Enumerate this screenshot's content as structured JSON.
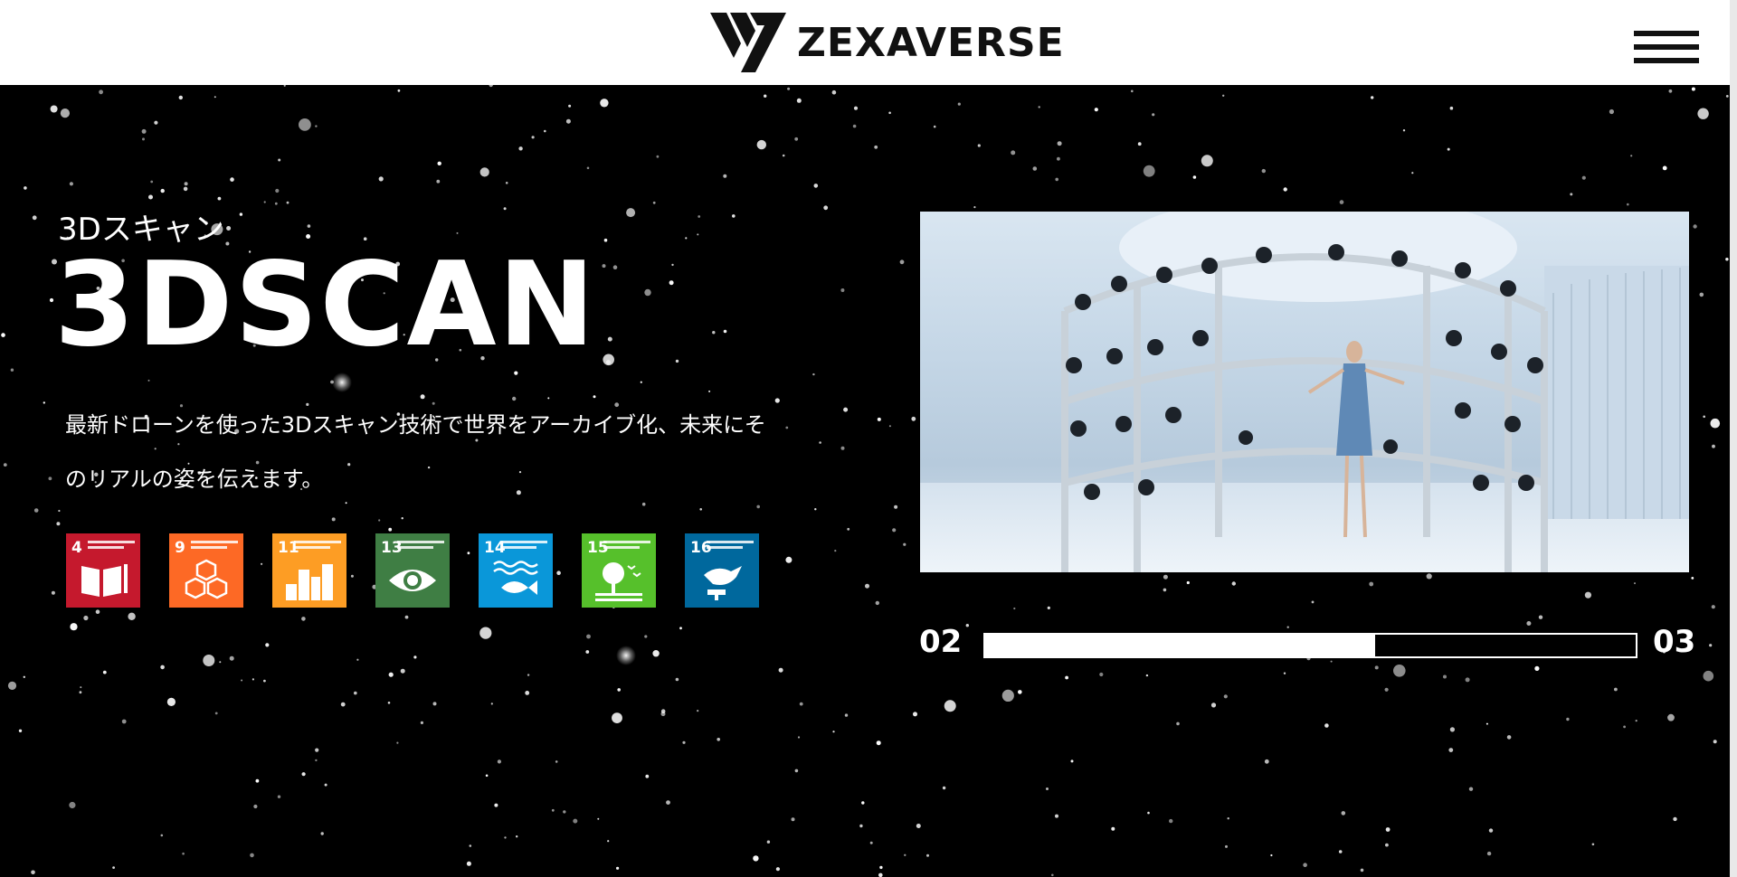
{
  "header": {
    "brand": "ZEXAVERSE",
    "menu_icon": "hamburger-icon"
  },
  "hero": {
    "subtitle": "3Dスキャン",
    "title": "3DSCAN",
    "description": "最新ドローンを使った3Dスキャン技術で世界をアーカイブ化、未来にそのリアルの姿を伝えます。",
    "sdgs": [
      {
        "number": "4",
        "color": "#c5192d",
        "icon": "book-pencil-icon"
      },
      {
        "number": "9",
        "color": "#fd6925",
        "icon": "cubes-icon"
      },
      {
        "number": "11",
        "color": "#fd9d24",
        "icon": "city-buildings-icon"
      },
      {
        "number": "13",
        "color": "#3f7e44",
        "icon": "eye-globe-icon"
      },
      {
        "number": "14",
        "color": "#0a97d9",
        "icon": "fish-waves-icon"
      },
      {
        "number": "15",
        "color": "#56c02b",
        "icon": "tree-birds-icon"
      },
      {
        "number": "16",
        "color": "#00689d",
        "icon": "dove-gavel-icon"
      }
    ]
  },
  "slider": {
    "current": "02",
    "next": "03",
    "progress": 0.6
  },
  "colors": {
    "background": "#000000",
    "header_bg": "#ffffff",
    "text": "#ffffff"
  }
}
